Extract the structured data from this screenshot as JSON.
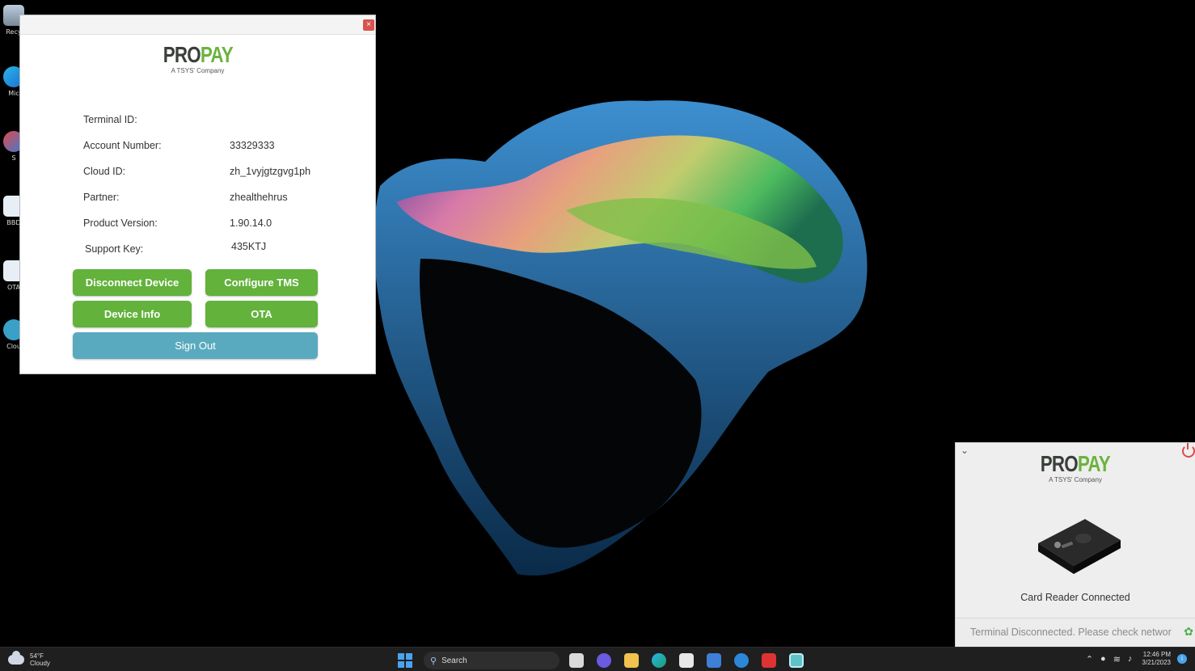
{
  "desktop": {
    "icons": [
      {
        "label": "Recy"
      },
      {
        "label": "Mic"
      },
      {
        "label": "S"
      },
      {
        "label": "BBD"
      },
      {
        "label": "OTA"
      },
      {
        "label": "Clou"
      }
    ]
  },
  "main_window": {
    "close_symbol": "×",
    "logo": {
      "pro": "PRO",
      "pay": "PAY",
      "tagline": "A TSYS' Company"
    },
    "fields": [
      {
        "label": "Terminal ID:",
        "value": ""
      },
      {
        "label": "Account Number:",
        "value": "33329333"
      },
      {
        "label": "Cloud ID:",
        "value": "zh_1vyjgtzgvg1ph"
      },
      {
        "label": "Partner:",
        "value": "zhealthehrus"
      },
      {
        "label": "Product Version:",
        "value": "1.90.14.0"
      },
      {
        "label": "Support Key:",
        "value": "435KTJ"
      }
    ],
    "buttons": {
      "disconnect": "Disconnect Device",
      "configure": "Configure TMS",
      "device_info": "Device Info",
      "ota": "OTA",
      "sign_out": "Sign Out"
    },
    "colors": {
      "green": "#62b23b",
      "blue": "#5aaabf"
    }
  },
  "status_window": {
    "logo": {
      "pro": "PRO",
      "pay": "PAY",
      "tagline": "A TSYS' Company"
    },
    "reader_status": "Card Reader Connected",
    "terminal_status": "Terminal Disconnected. Please check networ",
    "collapse_symbol": "⌄"
  },
  "taskbar": {
    "weather": {
      "temp": "54°F",
      "condition": "Cloudy"
    },
    "search_placeholder": "Search",
    "clock": {
      "time": "12:46 PM",
      "date": "3/21/2023"
    }
  }
}
